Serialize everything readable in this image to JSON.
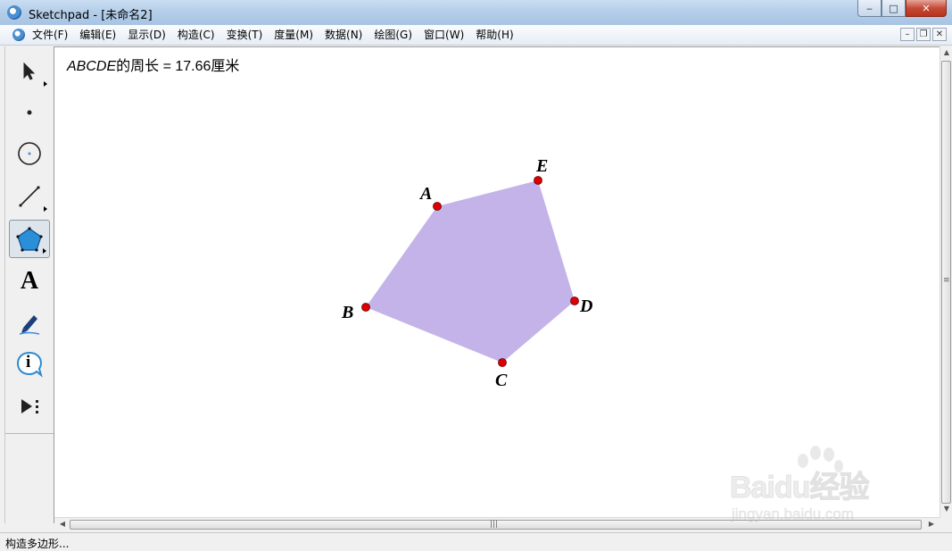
{
  "window": {
    "title": "Sketchpad  - [未命名2]",
    "minimize_label": "‒",
    "maximize_label": "□",
    "close_label": "✕"
  },
  "menu": {
    "items": [
      {
        "label": "文件(F)"
      },
      {
        "label": "编辑(E)"
      },
      {
        "label": "显示(D)"
      },
      {
        "label": "构造(C)"
      },
      {
        "label": "变换(T)"
      },
      {
        "label": "度量(M)"
      },
      {
        "label": "数据(N)"
      },
      {
        "label": "绘图(G)"
      },
      {
        "label": "窗口(W)"
      },
      {
        "label": "帮助(H)"
      }
    ],
    "mdi": {
      "minimize": "–",
      "restore": "❐",
      "close": "✕"
    }
  },
  "toolbox": {
    "tools": [
      {
        "name": "arrow-tool",
        "icon": "arrow-pointer-icon"
      },
      {
        "name": "point-tool",
        "icon": "point-icon"
      },
      {
        "name": "compass-tool",
        "icon": "circle-icon"
      },
      {
        "name": "straightedge-tool",
        "icon": "segment-icon"
      },
      {
        "name": "polygon-tool",
        "icon": "polygon-icon",
        "active": true
      },
      {
        "name": "text-tool",
        "icon": "letter-a-icon",
        "label": "A"
      },
      {
        "name": "marker-tool",
        "icon": "pen-icon"
      },
      {
        "name": "information-tool",
        "icon": "info-icon",
        "label": "i"
      },
      {
        "name": "custom-tool",
        "icon": "play-more-icon"
      }
    ]
  },
  "canvas": {
    "measurement": {
      "polygon_name": "ABCDE",
      "text": "的周长 = 17.66厘米"
    },
    "polygon": {
      "fill_color": "#c3b3e8",
      "point_color": "#dd0000",
      "points": [
        {
          "label": "A"
        },
        {
          "label": "B"
        },
        {
          "label": "C"
        },
        {
          "label": "D"
        },
        {
          "label": "E"
        }
      ]
    }
  },
  "scrollbars": {
    "up": "▲",
    "down": "▼",
    "left": "◀",
    "right": "▶",
    "grip_v": "≡",
    "grip_h": "|||"
  },
  "status": {
    "text": "构造多边形..."
  },
  "watermark": {
    "logo": "Baidu经验",
    "url": "jingyan.baidu.com"
  }
}
